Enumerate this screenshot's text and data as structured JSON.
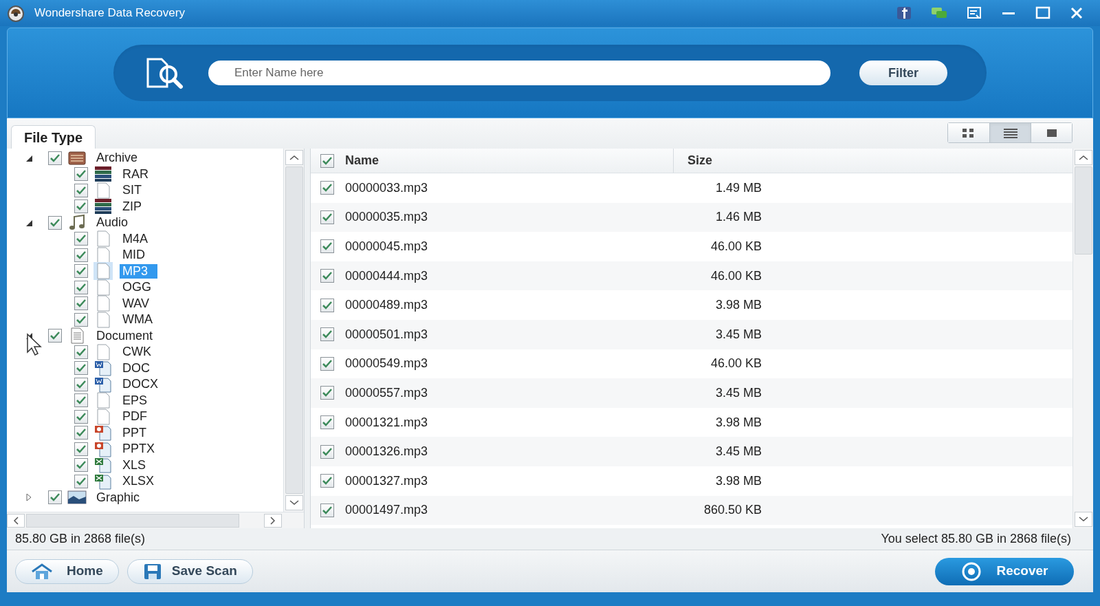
{
  "window": {
    "title": "Wondershare Data Recovery"
  },
  "search": {
    "placeholder": "Enter Name here",
    "button": "Filter"
  },
  "panel_tab": {
    "label": "File Type",
    "selected": true
  },
  "view_modes": [
    {
      "kind": "grid",
      "selected": false
    },
    {
      "kind": "list",
      "selected": true
    },
    {
      "kind": "detail",
      "selected": false
    }
  ],
  "tree": [
    {
      "label": "Archive",
      "kind": "archive",
      "checked": true,
      "expanded": true,
      "selected": false,
      "children": [
        {
          "label": "RAR",
          "kind": "books",
          "checked": true,
          "selected": false
        },
        {
          "label": "SIT",
          "kind": "blank",
          "checked": true,
          "selected": false
        },
        {
          "label": "ZIP",
          "kind": "books",
          "checked": true,
          "selected": false
        }
      ]
    },
    {
      "label": "Audio",
      "kind": "music",
      "checked": true,
      "expanded": true,
      "selected": false,
      "children": [
        {
          "label": "M4A",
          "kind": "blank",
          "checked": true,
          "selected": false
        },
        {
          "label": "MID",
          "kind": "blank",
          "checked": true,
          "selected": false
        },
        {
          "label": "MP3",
          "kind": "blank",
          "checked": true,
          "selected": true
        },
        {
          "label": "OGG",
          "kind": "blank",
          "checked": true,
          "selected": false
        },
        {
          "label": "WAV",
          "kind": "blank",
          "checked": true,
          "selected": false
        },
        {
          "label": "WMA",
          "kind": "blank",
          "checked": true,
          "selected": false
        }
      ]
    },
    {
      "label": "Document",
      "kind": "text",
      "checked": true,
      "expanded": true,
      "selected": false,
      "children": [
        {
          "label": "CWK",
          "kind": "blank",
          "checked": true,
          "selected": false
        },
        {
          "label": "DOC",
          "kind": "word",
          "checked": true,
          "selected": false
        },
        {
          "label": "DOCX",
          "kind": "word",
          "checked": true,
          "selected": false
        },
        {
          "label": "EPS",
          "kind": "blank",
          "checked": true,
          "selected": false
        },
        {
          "label": "PDF",
          "kind": "blank",
          "checked": true,
          "selected": false
        },
        {
          "label": "PPT",
          "kind": "slides",
          "checked": true,
          "selected": false
        },
        {
          "label": "PPTX",
          "kind": "slides",
          "checked": true,
          "selected": false
        },
        {
          "label": "XLS",
          "kind": "sheet",
          "checked": true,
          "selected": false
        },
        {
          "label": "XLSX",
          "kind": "sheet",
          "checked": true,
          "selected": false
        }
      ]
    },
    {
      "label": "Graphic",
      "kind": "image",
      "checked": true,
      "expanded": false,
      "selected": false
    }
  ],
  "table": {
    "all_checked": true,
    "columns": [
      "Name",
      "Size"
    ],
    "rows": [
      {
        "checked": true,
        "name": "00000033.mp3",
        "size": "1.49 MB"
      },
      {
        "checked": true,
        "name": "00000035.mp3",
        "size": "1.46 MB"
      },
      {
        "checked": true,
        "name": "00000045.mp3",
        "size": "46.00 KB"
      },
      {
        "checked": true,
        "name": "00000444.mp3",
        "size": "46.00 KB"
      },
      {
        "checked": true,
        "name": "00000489.mp3",
        "size": "3.98 MB"
      },
      {
        "checked": true,
        "name": "00000501.mp3",
        "size": "3.45 MB"
      },
      {
        "checked": true,
        "name": "00000549.mp3",
        "size": "46.00 KB"
      },
      {
        "checked": true,
        "name": "00000557.mp3",
        "size": "3.45 MB"
      },
      {
        "checked": true,
        "name": "00001321.mp3",
        "size": "3.98 MB"
      },
      {
        "checked": true,
        "name": "00001326.mp3",
        "size": "3.45 MB"
      },
      {
        "checked": true,
        "name": "00001327.mp3",
        "size": "3.98 MB"
      },
      {
        "checked": true,
        "name": "00001497.mp3",
        "size": "860.50 KB"
      }
    ]
  },
  "status_bar": {
    "total": "85.80 GB in 2868 file(s)",
    "selection": "You select 85.80 GB in 2868 file(s)"
  },
  "buttons": {
    "home": "Home",
    "save_scan": "Save Scan",
    "recover": "Recover"
  }
}
